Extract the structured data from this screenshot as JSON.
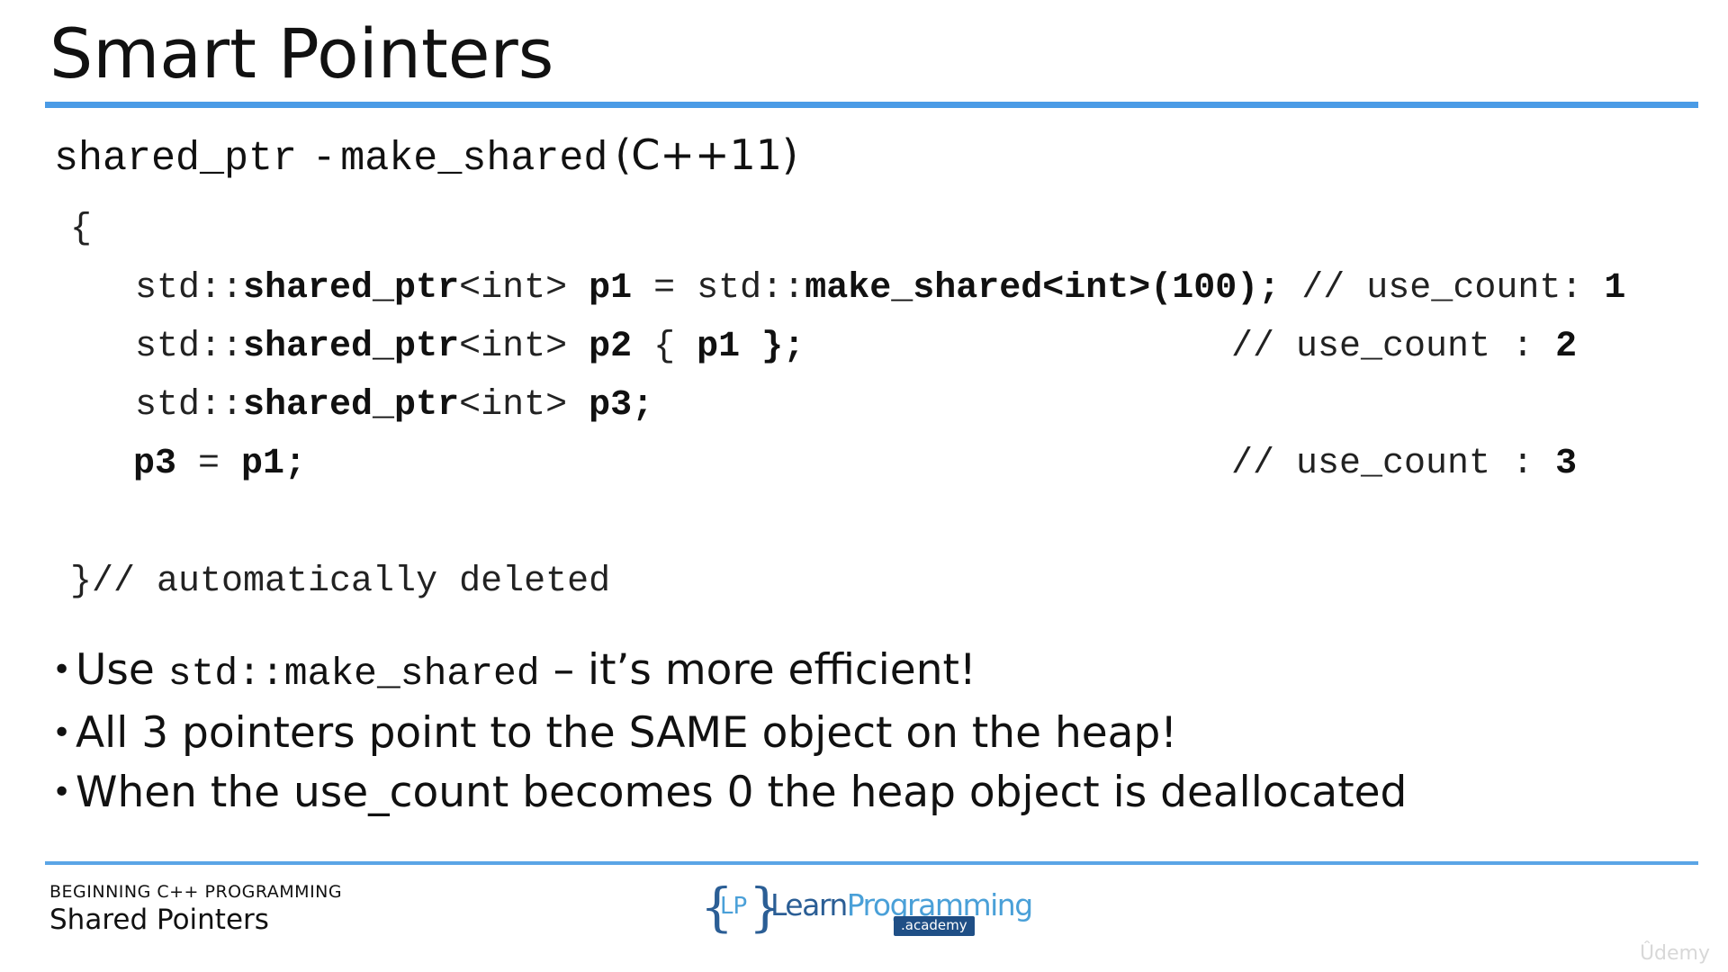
{
  "slide": {
    "title": "Smart Pointers"
  },
  "subtitle": {
    "code_a": "shared_ptr",
    "dash": "-",
    "code_b": "make_shared",
    "suffix": "(C++11)"
  },
  "code": {
    "open_brace": "{",
    "line1": {
      "std": "std::",
      "type": "shared_ptr",
      "tmpl": "<int>",
      "var": "p1",
      "eq": " = ",
      "std2": "std::",
      "call": "make_shared<int>(100);",
      "comment": " // use_count: ",
      "count": "1"
    },
    "line2": {
      "std": "std::",
      "type": "shared_ptr",
      "tmpl": "<int>",
      "var": "p2",
      "open": " { ",
      "arg": "p1",
      "close": " };",
      "comment": "// use_count : ",
      "count": "2"
    },
    "line3": {
      "std": "std::",
      "type": "shared_ptr",
      "tmpl": "<int>",
      "var": "p3;"
    },
    "line4": {
      "lhs": "p3",
      "eq": " = ",
      "rhs": "p1;",
      "comment": "// use_count : ",
      "count": "3"
    },
    "close_line": "}// automatically deleted"
  },
  "bullets": [
    {
      "pre": "Use ",
      "code": "std::make_shared",
      "post": " – it’s more efficient!"
    },
    {
      "text": "All 3 pointers point to the SAME object on the heap!"
    },
    {
      "text": "When the use_count becomes 0 the heap object is deallocated"
    }
  ],
  "footer": {
    "course": "BEGINNING C++ PROGRAMMING",
    "topic": "Shared Pointers"
  },
  "logo": {
    "open_brace": "{",
    "lp": "LP",
    "close_brace": "}",
    "learn": "Learn",
    "programming": "Programming",
    "academy": ".academy"
  },
  "watermark": "Ûdemy",
  "colors": {
    "accent_rule": "#4a9be6",
    "logo_dark": "#2b5e95",
    "logo_light": "#4aa0d8"
  }
}
